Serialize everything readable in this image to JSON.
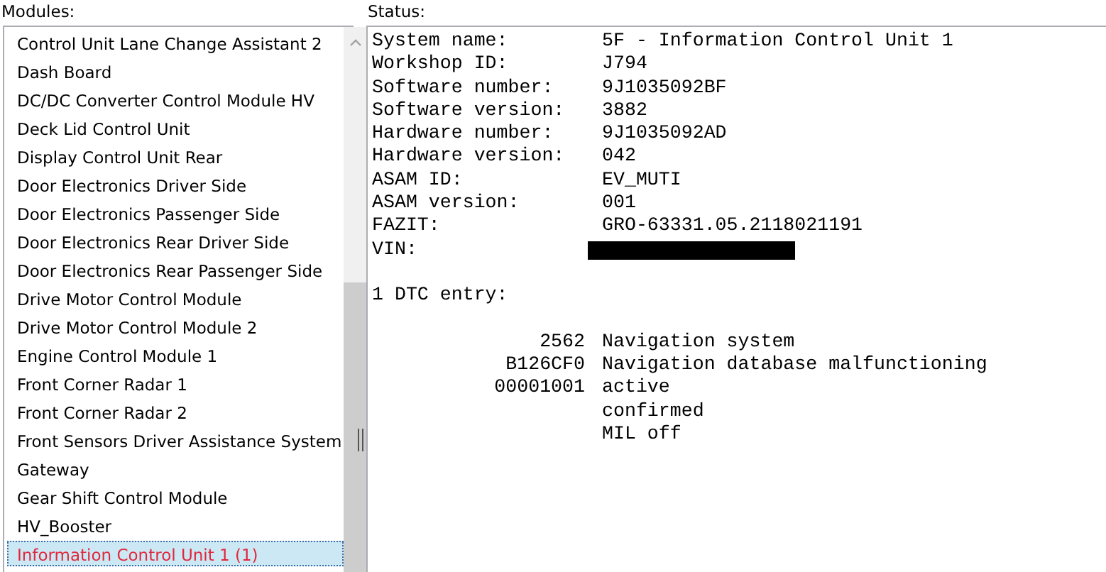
{
  "modules": {
    "label": "Modules:",
    "items": [
      {
        "label": "Control Unit Lane Change Assistant 2",
        "selected": false
      },
      {
        "label": "Dash Board",
        "selected": false
      },
      {
        "label": "DC/DC Converter Control Module HV",
        "selected": false
      },
      {
        "label": "Deck Lid Control Unit",
        "selected": false
      },
      {
        "label": "Display Control Unit Rear",
        "selected": false
      },
      {
        "label": "Door Electronics Driver Side",
        "selected": false
      },
      {
        "label": "Door Electronics Passenger Side",
        "selected": false
      },
      {
        "label": "Door Electronics Rear Driver Side",
        "selected": false
      },
      {
        "label": "Door Electronics Rear Passenger Side",
        "selected": false
      },
      {
        "label": "Drive Motor Control Module",
        "selected": false
      },
      {
        "label": "Drive Motor Control Module 2",
        "selected": false
      },
      {
        "label": "Engine Control Module 1",
        "selected": false
      },
      {
        "label": "Front Corner Radar 1",
        "selected": false
      },
      {
        "label": "Front Corner Radar 2",
        "selected": false
      },
      {
        "label": "Front Sensors Driver Assistance System",
        "selected": false
      },
      {
        "label": "Gateway",
        "selected": false
      },
      {
        "label": "Gear Shift Control Module",
        "selected": false
      },
      {
        "label": "HV_Booster",
        "selected": false
      },
      {
        "label": "Information Control Unit 1 (1)",
        "selected": true
      }
    ]
  },
  "status": {
    "label": "Status:",
    "info": [
      {
        "kind": "text",
        "key": "System name:",
        "value": "5F - Information Control Unit 1"
      },
      {
        "kind": "text",
        "key": "Workshop ID:",
        "value": "J794"
      },
      {
        "kind": "text",
        "key": "Software number:",
        "value": "9J1035092BF"
      },
      {
        "kind": "text",
        "key": "Software version:",
        "value": "3882"
      },
      {
        "kind": "text",
        "key": "Hardware number:",
        "value": "9J1035092AD"
      },
      {
        "kind": "text",
        "key": "Hardware version:",
        "value": "042"
      },
      {
        "kind": "text",
        "key": "ASAM ID:",
        "value": "EV_MUTI"
      },
      {
        "kind": "text",
        "key": "ASAM version:",
        "value": "001"
      },
      {
        "kind": "text",
        "key": "FAZIT:",
        "value": "GRO-63331.05.2118021191"
      },
      {
        "kind": "redacted",
        "key": "VIN:"
      }
    ],
    "dtc_heading": "1 DTC entry:",
    "dtc_lines": [
      {
        "code": "2562",
        "text": "Navigation system"
      },
      {
        "code": "B126CF0",
        "text": "Navigation database malfunctioning"
      },
      {
        "code": "00001001",
        "text": "active"
      },
      {
        "text": "confirmed"
      },
      {
        "text": "MIL off"
      }
    ]
  }
}
